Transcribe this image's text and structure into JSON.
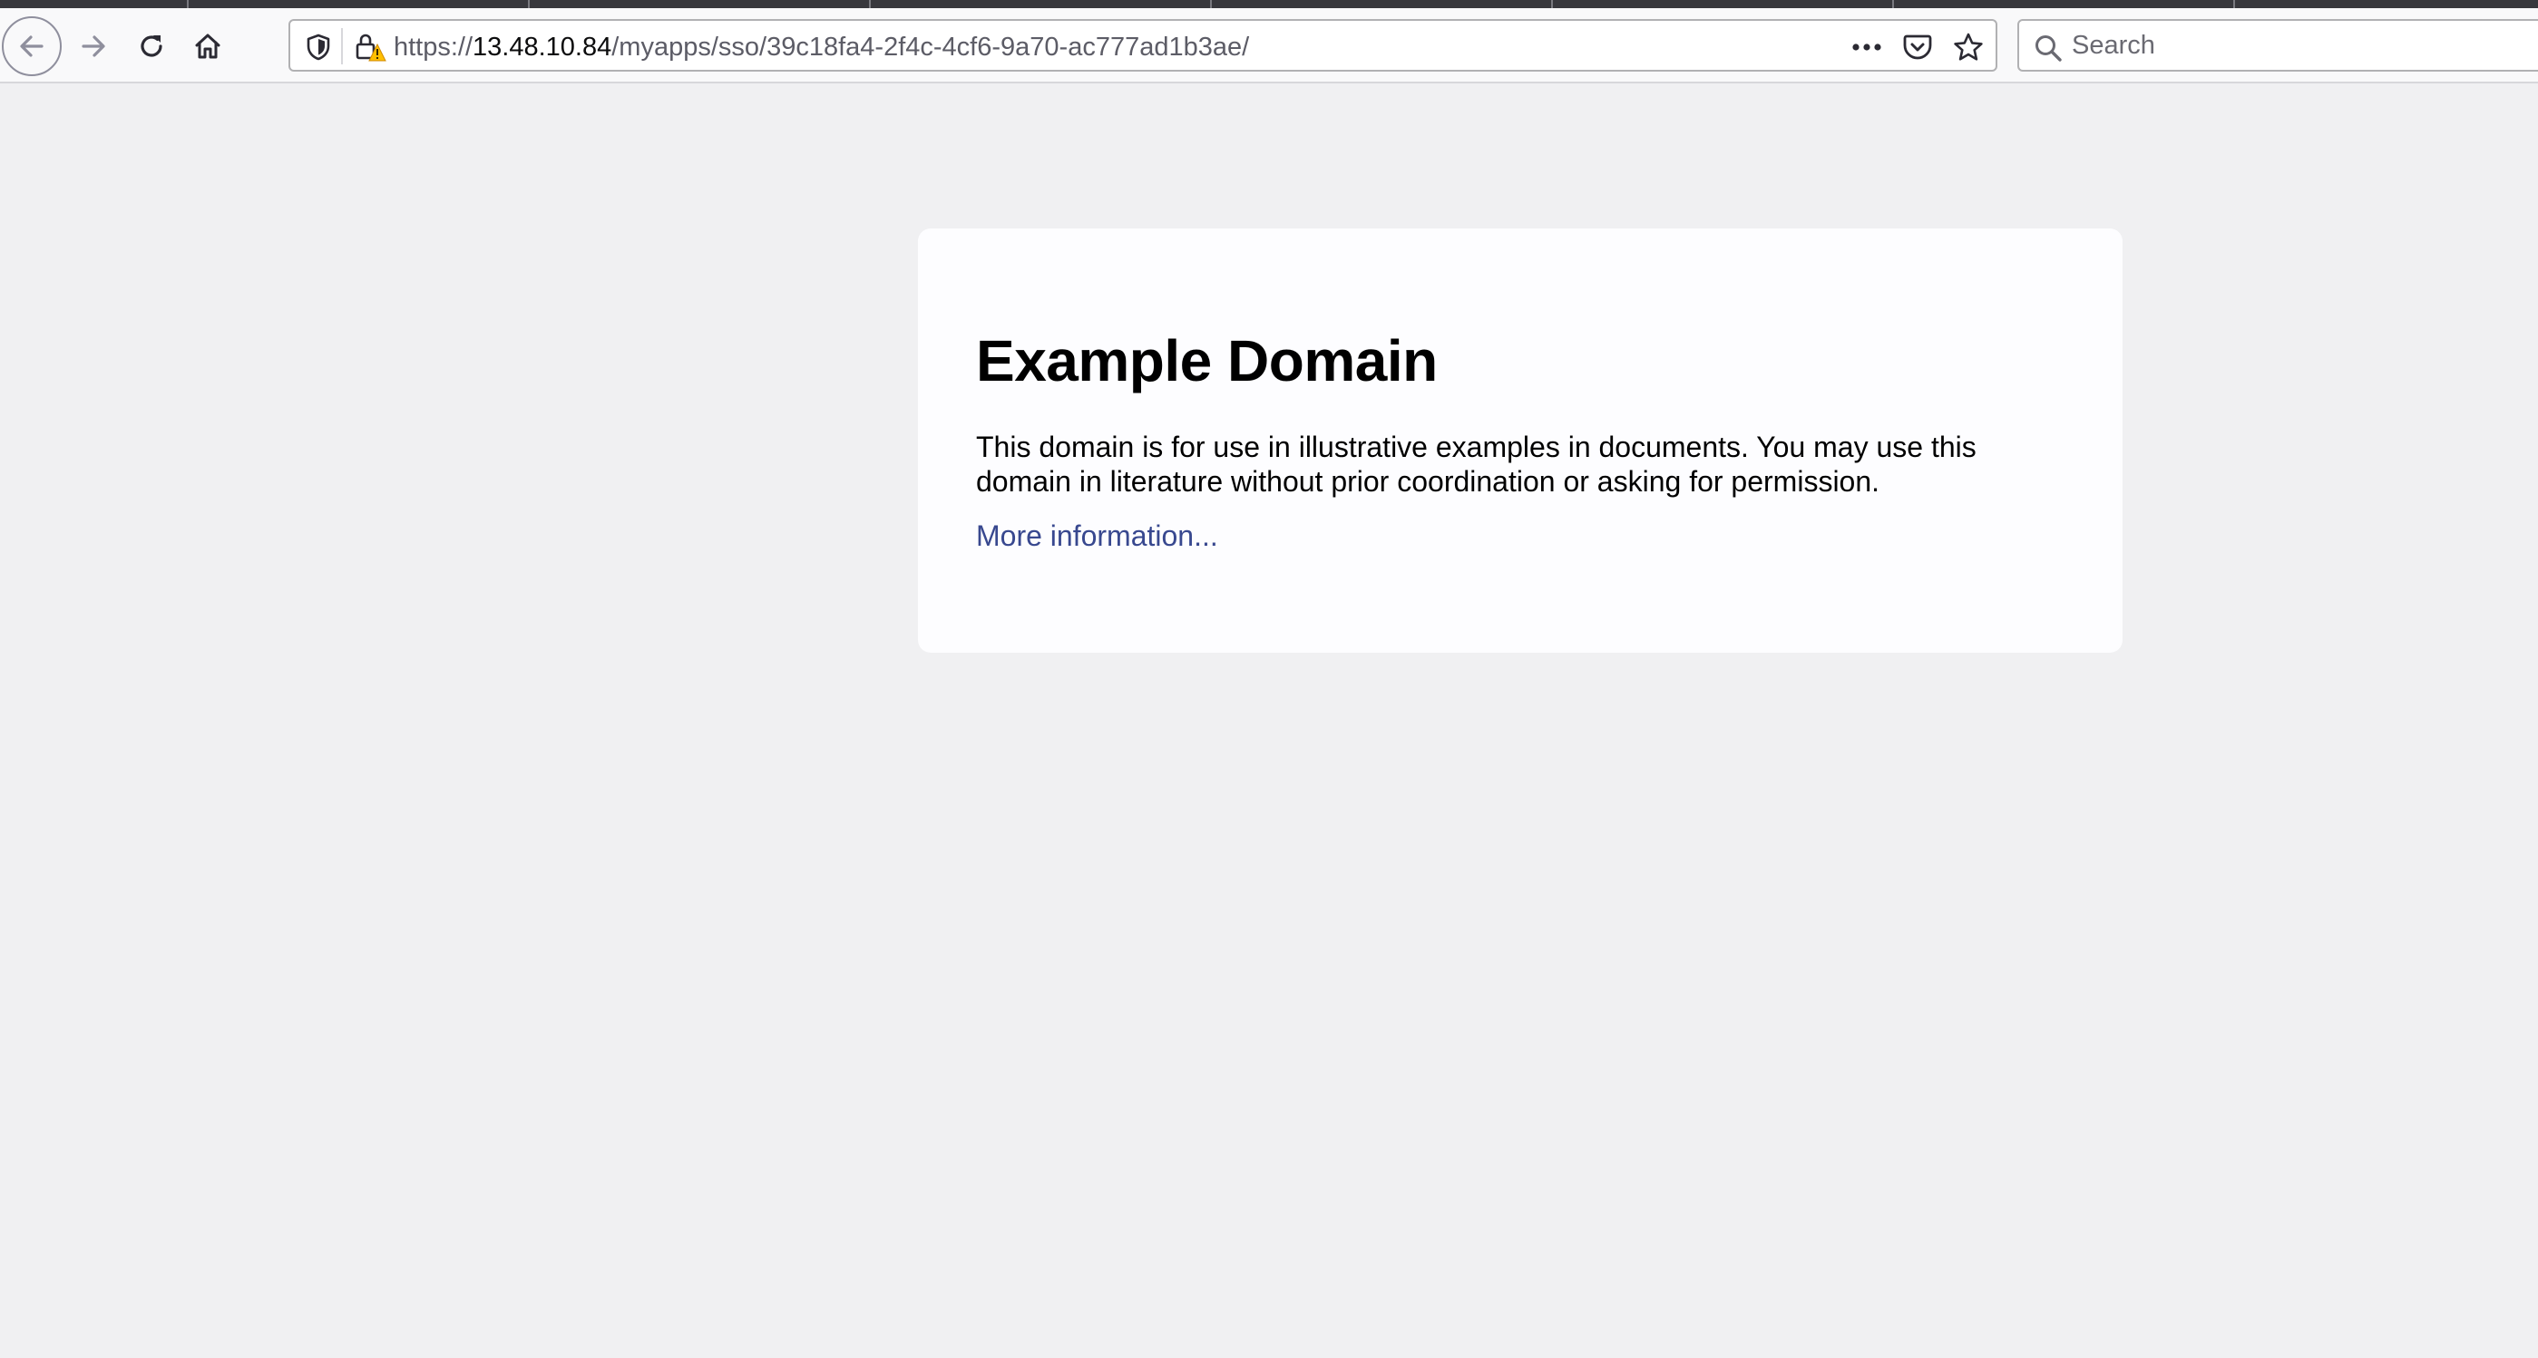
{
  "browser": {
    "url": {
      "scheme": "https://",
      "host": "13.48.10.84",
      "path": "/myapps/sso/39c18fa4-2f4c-4cf6-9a70-ac777ad1b3ae/"
    },
    "search": {
      "placeholder": "Search"
    },
    "icons": {
      "back": "back-arrow-icon",
      "forward": "forward-arrow-icon",
      "reload": "reload-icon",
      "home": "home-icon",
      "tracking_protection": "shield-icon",
      "insecure_connection": "lock-warning-icon",
      "page_actions": "more-dots-icon",
      "pocket": "pocket-icon",
      "bookmark": "star-icon",
      "search": "search-icon"
    },
    "colors": {
      "tabstrip": "#38383d",
      "toolbar": "#f9f9fa",
      "warning": "#ffbf00"
    }
  },
  "page": {
    "heading": "Example Domain",
    "description": "This domain is for use in illustrative examples in documents. You may use this domain in literature without prior coordination or asking for permission.",
    "link_label": "More information...",
    "colors": {
      "background": "#f0f0f2",
      "card": "#fdfdff",
      "link": "#38488f"
    }
  }
}
